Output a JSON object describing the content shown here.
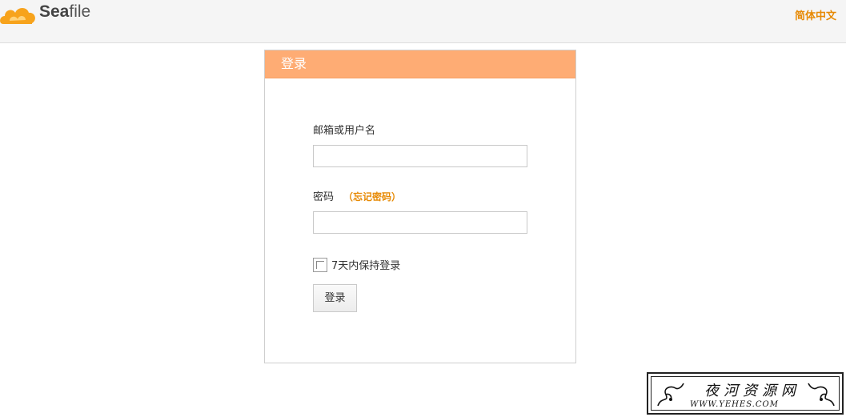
{
  "app": {
    "logo_text_bold": "Sea",
    "logo_text_rest": "file",
    "language_link": "简体中文"
  },
  "login": {
    "header_title": "登录",
    "username_label": "邮箱或用户名",
    "username_value": "",
    "password_label": "密码",
    "forgot_password_link": "（忘记密码）",
    "password_value": "",
    "remember_label": "7天内保持登录",
    "remember_checked": false,
    "submit_label": "登录"
  },
  "watermark": {
    "title": "夜河资源网",
    "url": "WWW.YEHES.COM"
  },
  "colors": {
    "accent": "#e78a05",
    "header_bg": "#feac74",
    "logo_orange": "#f7a31c"
  },
  "icons": {
    "logo": "seafile-cloud-logo-icon",
    "checkbox": "checkbox-unchecked-icon",
    "swirl_left": "ornament-swirl-icon",
    "swirl_right": "ornament-swirl-icon"
  }
}
